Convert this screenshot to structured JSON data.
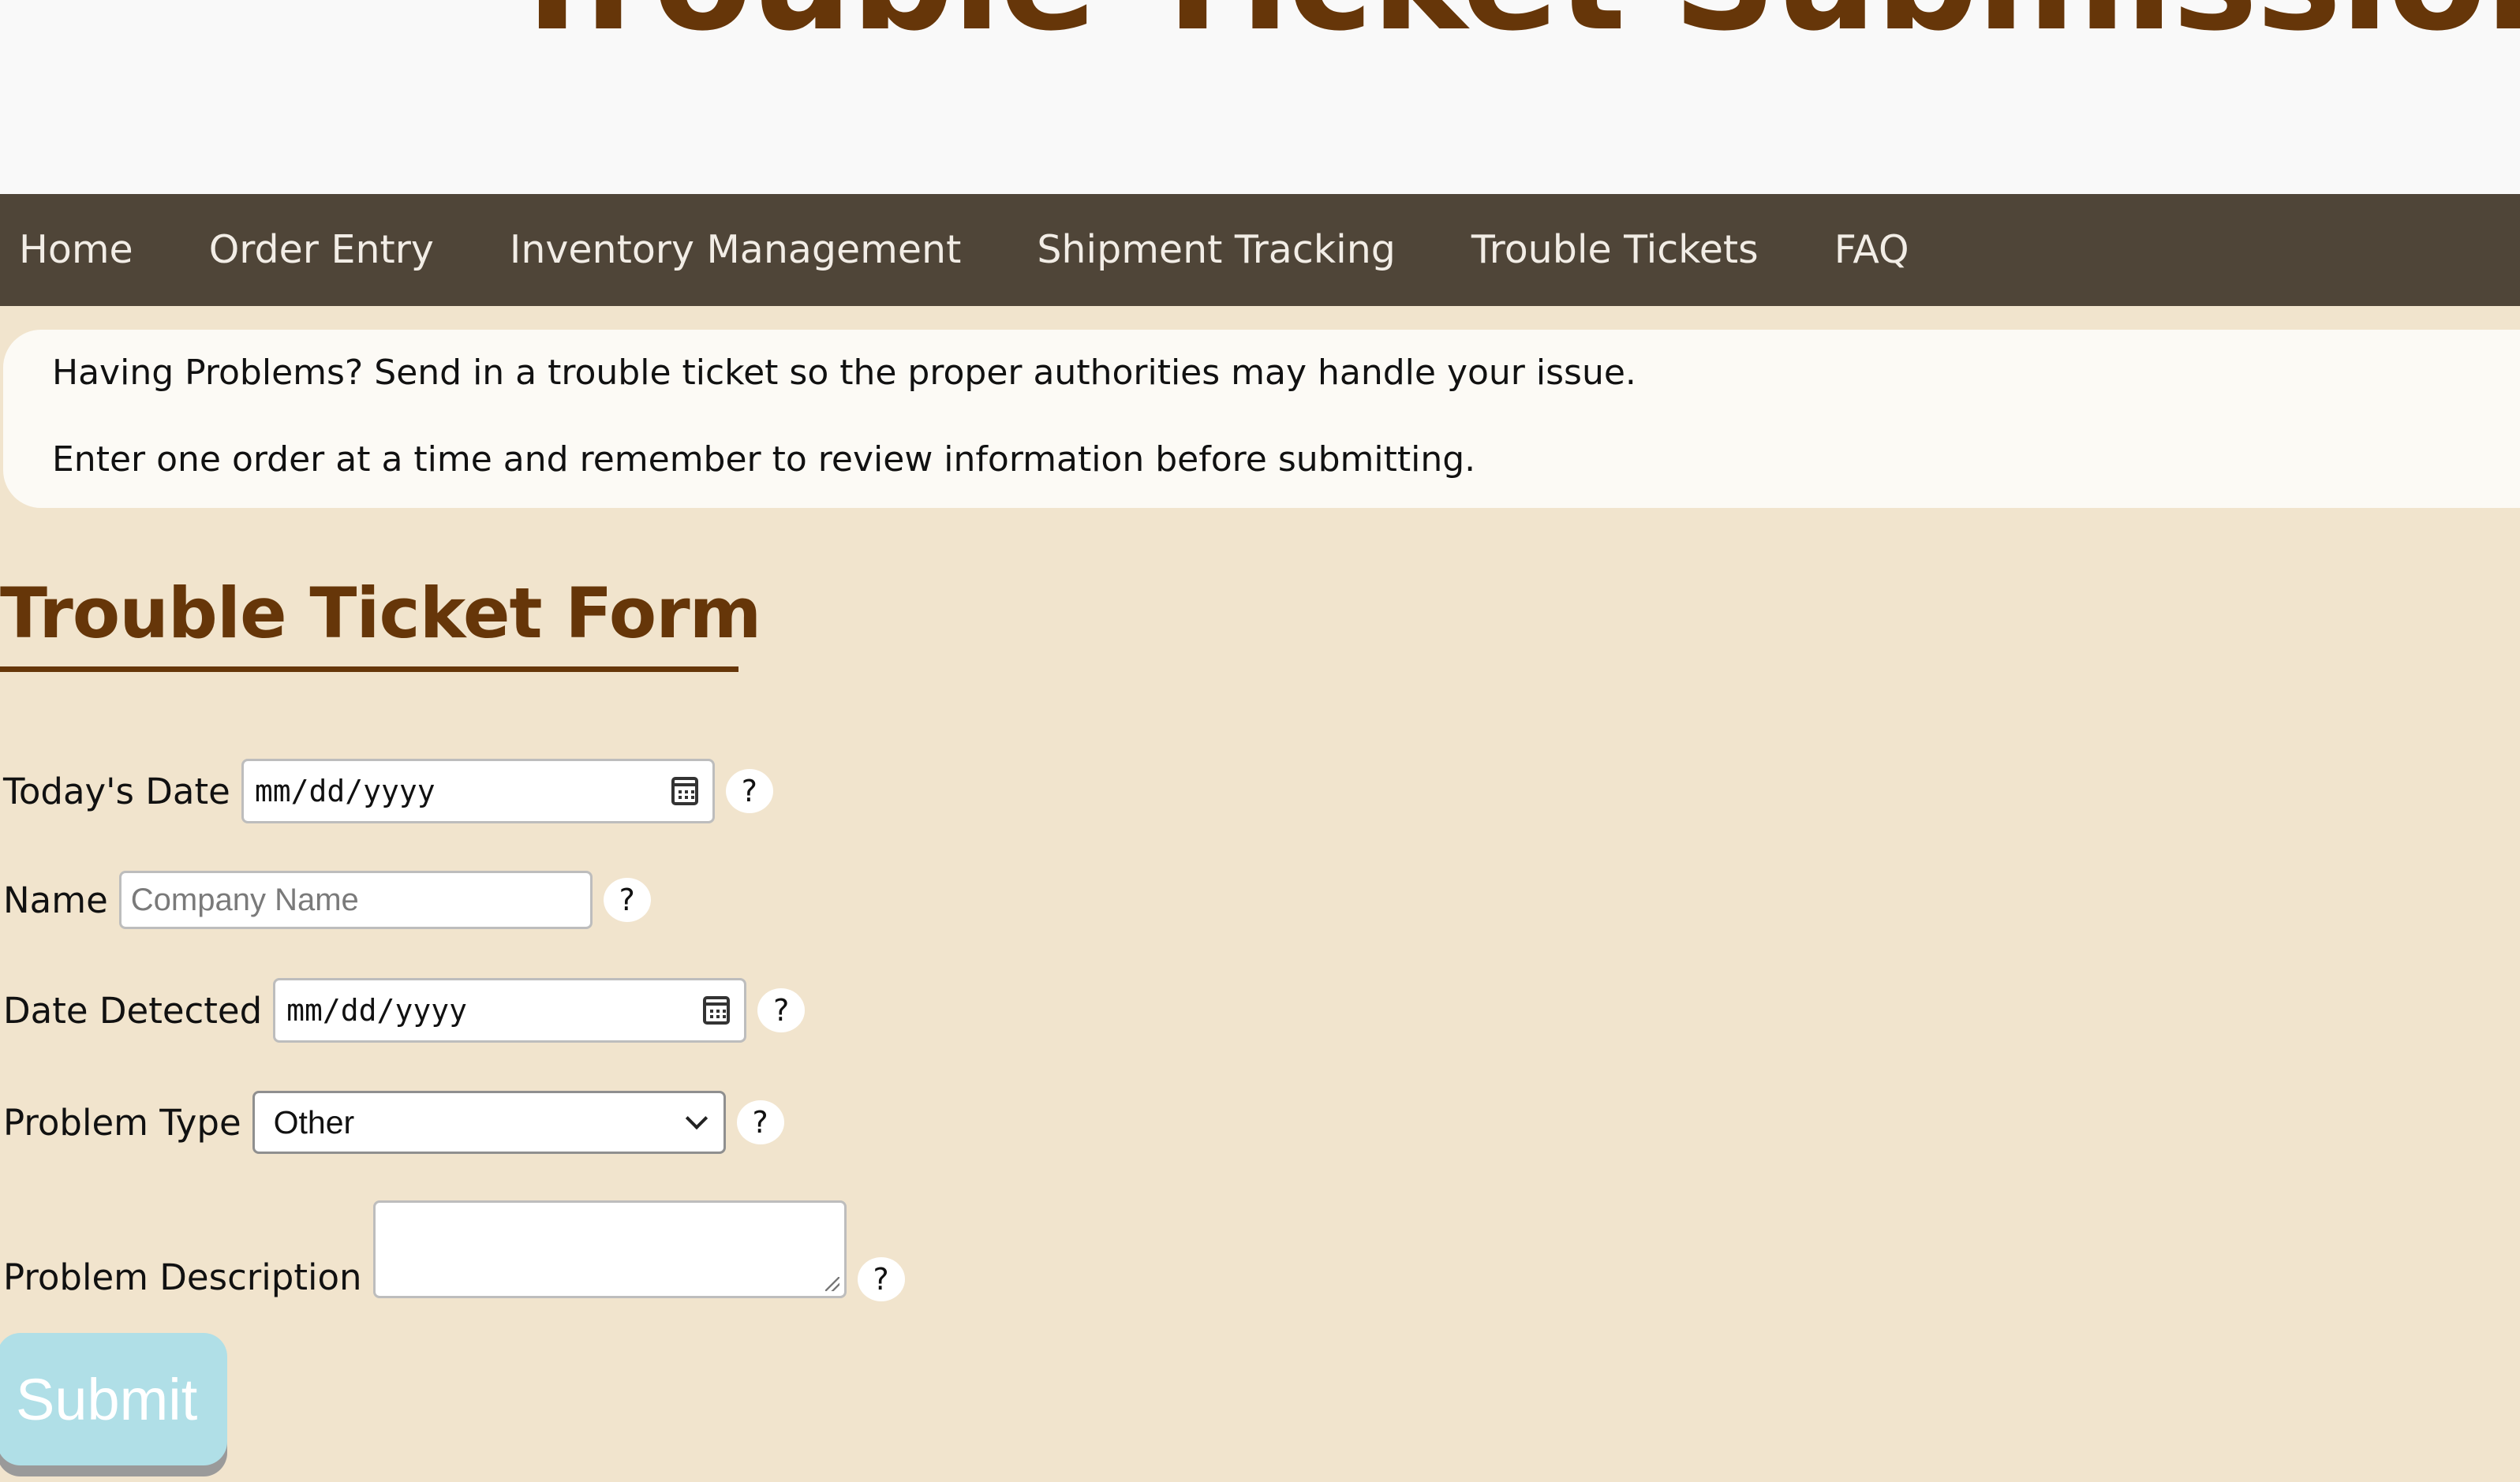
{
  "header": {
    "title": "Trouble Ticket Submission"
  },
  "nav": {
    "items": [
      {
        "label": "Home"
      },
      {
        "label": "Order Entry"
      },
      {
        "label": "Inventory Management"
      },
      {
        "label": "Shipment Tracking"
      },
      {
        "label": "Trouble Tickets"
      },
      {
        "label": "FAQ"
      }
    ]
  },
  "intro": {
    "line1": "Having Problems? Send in a trouble ticket so the proper authorities may handle your issue.",
    "line2": "Enter one order at a time and remember to review information before submitting."
  },
  "form": {
    "title": "Trouble Ticket Form",
    "todays_date": {
      "label": "Today's Date",
      "value": "mm/dd/yyyy",
      "help": "?"
    },
    "name": {
      "label": "Name",
      "value": "",
      "placeholder": "Company Name",
      "help": "?"
    },
    "date_detected": {
      "label": "Date Detected",
      "value": "mm/dd/yyyy",
      "help": "?"
    },
    "problem_type": {
      "label": "Problem Type",
      "value": "Other",
      "help": "?"
    },
    "problem_description": {
      "label": "Problem Description",
      "value": "",
      "help": "?"
    },
    "submit_label": "Submit"
  },
  "icons": {
    "calendar": "calendar-icon",
    "dropdown": "chevron-down-icon",
    "resize": "resize-grip-icon"
  },
  "colors": {
    "heading_brown": "#663609",
    "nav_bg": "#4f4538",
    "page_bg": "#f1e4cd",
    "submit_bg": "#b0dfe7"
  }
}
